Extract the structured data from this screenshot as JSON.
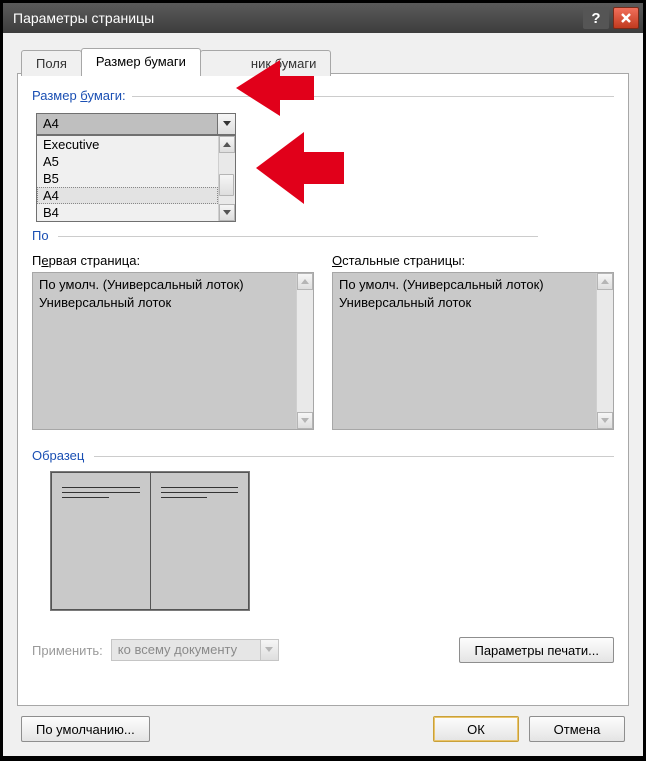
{
  "titlebar": {
    "title": "Параметры страницы"
  },
  "tabs": {
    "t0": "Поля",
    "t1": "Размер бумаги",
    "t2": "ник бумаги"
  },
  "paper_size": {
    "group_label_prefix": "Размер ",
    "group_label_u": "б",
    "group_label_suffix": "умаги:",
    "selected": "A4",
    "opt0": "Executive",
    "opt1": "A5",
    "opt2": "B5",
    "opt3": "A4",
    "opt4": "B4"
  },
  "source": {
    "group_partial_prefix": "По",
    "first_label_prefix": "П",
    "first_label_u": "е",
    "first_label_suffix": "рвая страница:",
    "other_label_prefix": "",
    "other_label_u": "О",
    "other_label_suffix": "стальные страницы:",
    "first_opt0": "По умолч. (Универсальный лоток)",
    "first_opt1": "Универсальный лоток",
    "other_opt0": "По умолч. (Универсальный лоток)",
    "other_opt1": "Универсальный лоток"
  },
  "sample": {
    "label": "Образец"
  },
  "apply": {
    "label": "Применить:",
    "value": "ко всему документу"
  },
  "buttons": {
    "print_opts": "Параметры печати...",
    "defaults": "По умолчанию...",
    "ok": "ОК",
    "cancel": "Отмена"
  }
}
